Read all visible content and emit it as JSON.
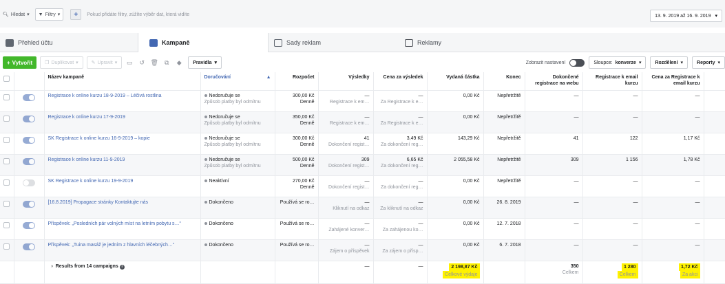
{
  "search": {
    "find_label": "Hledat",
    "filters_label": "Filtry",
    "placeholder": "Pokud přidáte filtry, zúžíte výběr dat, která vidíte"
  },
  "date_range": "13. 9. 2019 až 16. 9. 2019",
  "tabs": [
    {
      "label": "Přehled účtu"
    },
    {
      "label": "Kampaně"
    },
    {
      "label": "Sady reklam"
    },
    {
      "label": "Reklamy"
    }
  ],
  "toolbar": {
    "create": "Vytvořit",
    "duplicate": "Duplikovat",
    "edit": "Upravit",
    "rules": "Pravidla",
    "show_settings": "Zobrazit nastavení",
    "columns_prefix": "Sloupce:",
    "columns_value": "konverze",
    "breakdown": "Rozdělení",
    "reports": "Reporty"
  },
  "columns": [
    "Název kampaně",
    "Doručování",
    "Rozpočet",
    "Výsledky",
    "Cena za výsledek",
    "Vydaná částka",
    "Konec",
    "Dokončené registrace na webu",
    "Registrace k email kurzu",
    "Cena za Registrace k email kurzu"
  ],
  "rows": [
    {
      "name": "Registrace k online kurzu 18-9-2019 – Léčivá rostlina",
      "on": true,
      "d1": "Nedoručuje se",
      "d2": "Způsob platby byl odmítnu",
      "b1": "300,00 Kč",
      "b2": "Denně",
      "r1": "—",
      "r2": "Registrace k em…",
      "c1": "—",
      "c2": "Za Registrace k e…",
      "spent": "0,00 Kč",
      "end": "Nepřetržitě",
      "reg": "—",
      "email": "—",
      "cost": "—"
    },
    {
      "name": "Registrace k online kurzu 17-9-2019",
      "on": true,
      "d1": "Nedoručuje se",
      "d2": "Způsob platby byl odmítnu",
      "b1": "350,00 Kč",
      "b2": "Denně",
      "r1": "—",
      "r2": "Registrace k em…",
      "c1": "—",
      "c2": "Za Registrace k e…",
      "spent": "0,00 Kč",
      "end": "Nepřetržitě",
      "reg": "—",
      "email": "—",
      "cost": "—"
    },
    {
      "name": "SK Registrace k online kurzu 16-9-2019 – kopie",
      "on": true,
      "d1": "Nedoručuje se",
      "d2": "Způsob platby byl odmítnu",
      "b1": "300,00 Kč",
      "b2": "Denně",
      "r1": "41",
      "r2": "Dokončení regist…",
      "c1": "3,49 Kč",
      "c2": "Za dokončení reg…",
      "spent": "143,29 Kč",
      "end": "Nepřetržitě",
      "reg": "41",
      "email": "122",
      "cost": "1,17 Kč"
    },
    {
      "name": "Registrace k online kurzu 11-9-2019",
      "on": true,
      "d1": "Nedoručuje se",
      "d2": "Způsob platby byl odmítnu",
      "b1": "500,00 Kč",
      "b2": "Denně",
      "r1": "309",
      "r2": "Dokončení regist…",
      "c1": "6,65 Kč",
      "c2": "Za dokončení reg…",
      "spent": "2 055,58 Kč",
      "end": "Nepřetržitě",
      "reg": "309",
      "email": "1 156",
      "cost": "1,78 Kč"
    },
    {
      "name": "SK Registrace k online kurzu 19-9-2019",
      "on": false,
      "d1": "Neaktivní",
      "d2": "",
      "b1": "270,00 Kč",
      "b2": "Denně",
      "r1": "—",
      "r2": "Dokončení regist…",
      "c1": "—",
      "c2": "Za dokončení reg…",
      "spent": "0,00 Kč",
      "end": "Nepřetržitě",
      "reg": "—",
      "email": "—",
      "cost": "—"
    },
    {
      "name": "[16.8.2019] Propagace stránky Kontaktujte nás",
      "on": true,
      "d1": "Dokončeno",
      "d2": "",
      "b1": "Používá se ro…",
      "b2": "",
      "r1": "—",
      "r2": "Kliknutí na odkaz",
      "c1": "—",
      "c2": "Za kliknutí na odkaz",
      "spent": "0,00 Kč",
      "end": "26. 8. 2019",
      "reg": "—",
      "email": "—",
      "cost": "—"
    },
    {
      "name": "Příspěvek: „Posledních pár volných míst na letním pobytu s…“",
      "on": true,
      "d1": "Dokončeno",
      "d2": "",
      "b1": "Používá se ro…",
      "b2": "",
      "r1": "—",
      "r2": "Zahájené konver…",
      "c1": "—",
      "c2": "Za zahájenou ko…",
      "spent": "0,00 Kč",
      "end": "12. 7. 2018",
      "reg": "—",
      "email": "—",
      "cost": "—"
    },
    {
      "name": "Příspěvek: „Tuina masáž je jedním z hlavních léčebných…“",
      "on": true,
      "d1": "Dokončeno",
      "d2": "",
      "b1": "Používá se ro…",
      "b2": "",
      "r1": "—",
      "r2": "Zájem o příspěvek",
      "c1": "—",
      "c2": "Za zájem o přísp…",
      "spent": "0,00 Kč",
      "end": "6. 7. 2018",
      "reg": "—",
      "email": "—",
      "cost": "—"
    }
  ],
  "footer": {
    "label": "Results from 14 campaigns",
    "results": "—",
    "cost": "—",
    "spent": "2 198,87 Kč",
    "spent_sub": "Celkové výdaje",
    "reg": "350",
    "reg_sub": "Celkem",
    "email": "1 280",
    "email_sub": "Celkem",
    "email_cost": "1,72 Kč",
    "email_cost_sub": "Za akci"
  },
  "colors": {
    "accent": "#4267b2",
    "create": "#42b72a",
    "highlight": "#fff200"
  }
}
